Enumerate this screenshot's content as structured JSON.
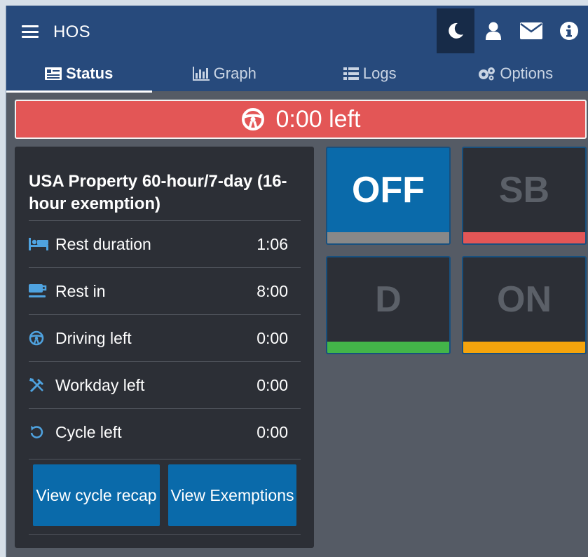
{
  "header": {
    "title": "HOS",
    "icons": [
      "moon-icon",
      "user-icon",
      "envelope-icon",
      "info-icon"
    ]
  },
  "tabs": [
    {
      "label": "Status",
      "icon": "status-icon",
      "active": true
    },
    {
      "label": "Graph",
      "icon": "bar-chart-icon",
      "active": false
    },
    {
      "label": "Logs",
      "icon": "list-icon",
      "active": false
    },
    {
      "label": "Options",
      "icon": "gears-icon",
      "active": false
    }
  ],
  "alert": {
    "text": "0:00 left",
    "icon": "steering-wheel-icon",
    "color": "#e35656"
  },
  "panel": {
    "title": "USA Property 60-hour/7-day (16-hour exemption)",
    "rows": [
      {
        "label": "Rest duration",
        "value": "1:06",
        "icon": "bed-icon"
      },
      {
        "label": "Rest in",
        "value": "8:00",
        "icon": "coffee-icon"
      },
      {
        "label": "Driving left",
        "value": "0:00",
        "icon": "steering-wheel-icon"
      },
      {
        "label": "Workday left",
        "value": "0:00",
        "icon": "tools-icon"
      },
      {
        "label": "Cycle left",
        "value": "0:00",
        "icon": "cycle-icon"
      }
    ],
    "buttons": {
      "cycle_recap": "View cycle recap",
      "exemptions": "View Exemptions"
    }
  },
  "statuses": [
    {
      "label": "OFF",
      "active": true,
      "bar_color": "#888888"
    },
    {
      "label": "SB",
      "active": false,
      "bar_color": "#e35656"
    },
    {
      "label": "D",
      "active": false,
      "bar_color": "#43b549"
    },
    {
      "label": "ON",
      "active": false,
      "bar_color": "#f5a40c"
    }
  ],
  "colors": {
    "header": "#274a7c",
    "accent": "#0a6aaa",
    "panel": "#2c2f36"
  }
}
